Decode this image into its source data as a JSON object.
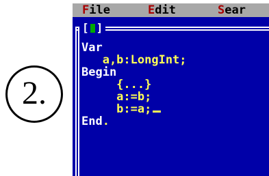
{
  "step": {
    "number": "2."
  },
  "menubar": {
    "file": {
      "hot": "F",
      "rest": "ile"
    },
    "edit": {
      "hot": "E",
      "rest": "dit"
    },
    "search": {
      "hot": "S",
      "rest": "ear"
    }
  },
  "window": {
    "close_box_left": "[",
    "close_box_right": "]"
  },
  "code_lines": {
    "l1": "Var",
    "l2": "   a,b:LongInt;",
    "l3": "Begin",
    "l4": "     {...}",
    "l5": "     a:=b;",
    "l6": "     b:=a;",
    "l7": "End",
    "l7_dot": "."
  },
  "colors": {
    "editor_bg": "#0000a8",
    "menu_bg": "#a8a8a8",
    "hotkey": "#a80000",
    "keyword": "#ffffff",
    "text": "#ffff55",
    "close_box_square": "#00a800"
  }
}
